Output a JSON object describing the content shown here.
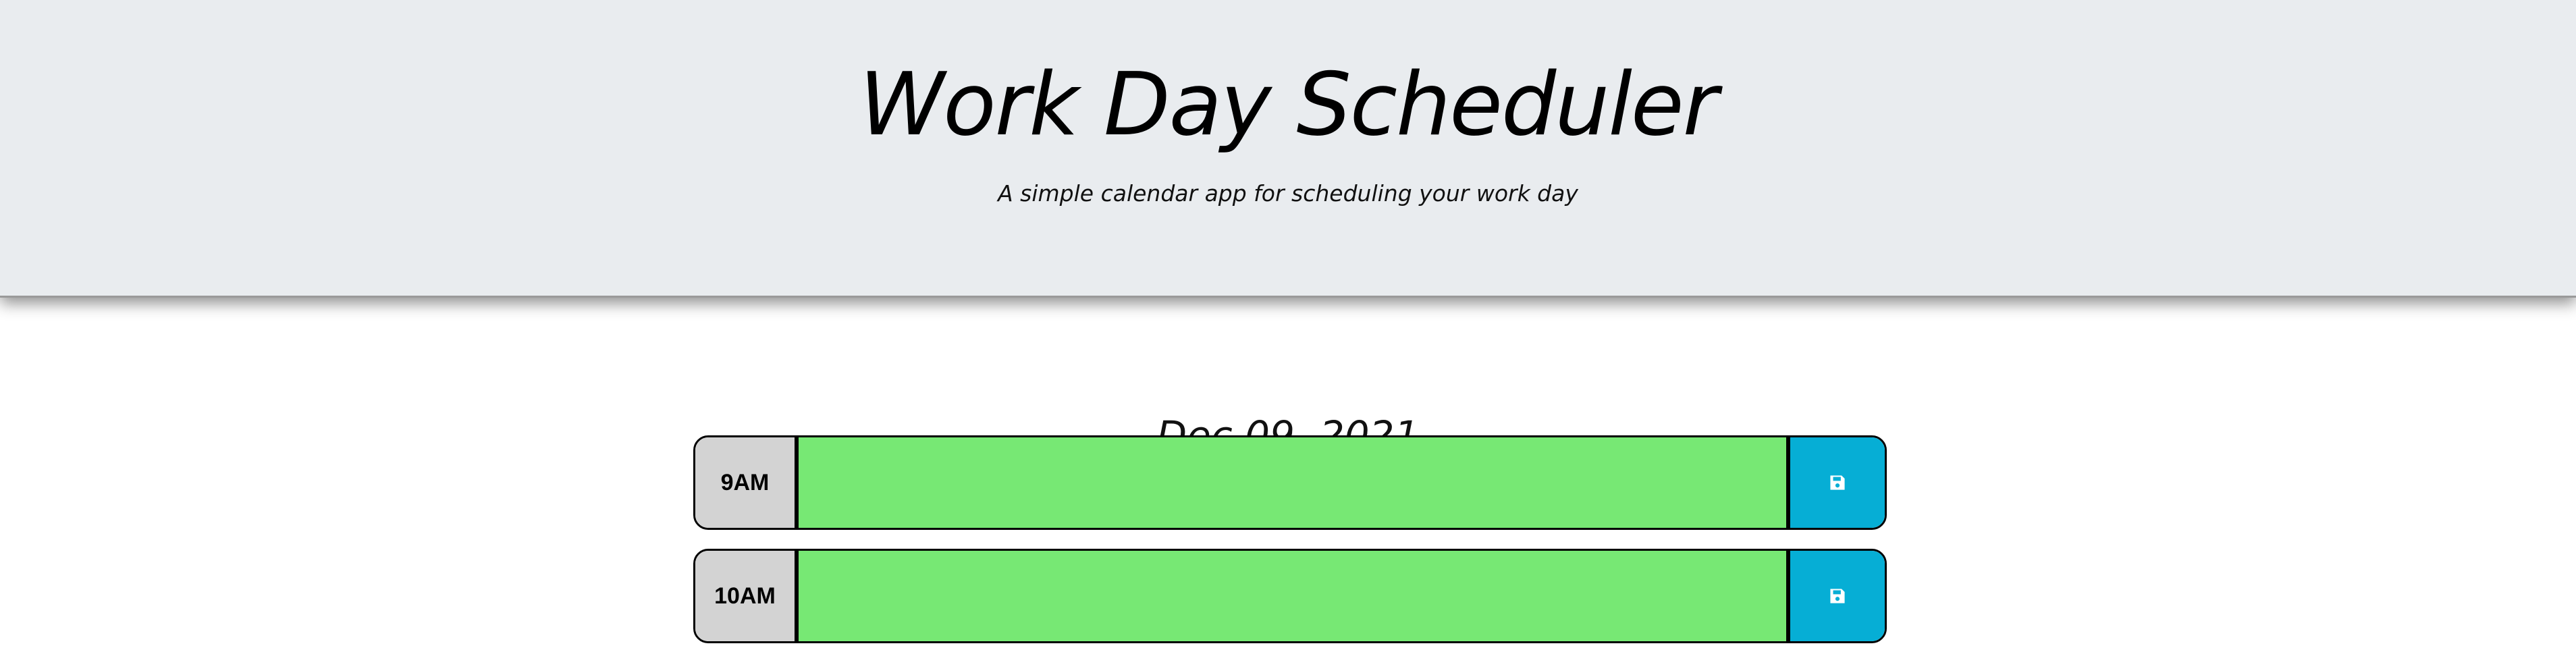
{
  "header": {
    "title": "Work Day Scheduler",
    "subtitle": "A simple calendar app for scheduling your work day"
  },
  "current_day": "Dec 09, 2021",
  "colors": {
    "header_bg": "#e9ecef",
    "future_block": "#77e874",
    "hour_bg": "#d3d3d3",
    "save_button": "#06aed5"
  },
  "time_blocks": [
    {
      "hour": "9AM",
      "description": "",
      "status": "future",
      "save_icon": "floppy-disk-icon"
    },
    {
      "hour": "10AM",
      "description": "",
      "status": "future",
      "save_icon": "floppy-disk-icon"
    }
  ]
}
